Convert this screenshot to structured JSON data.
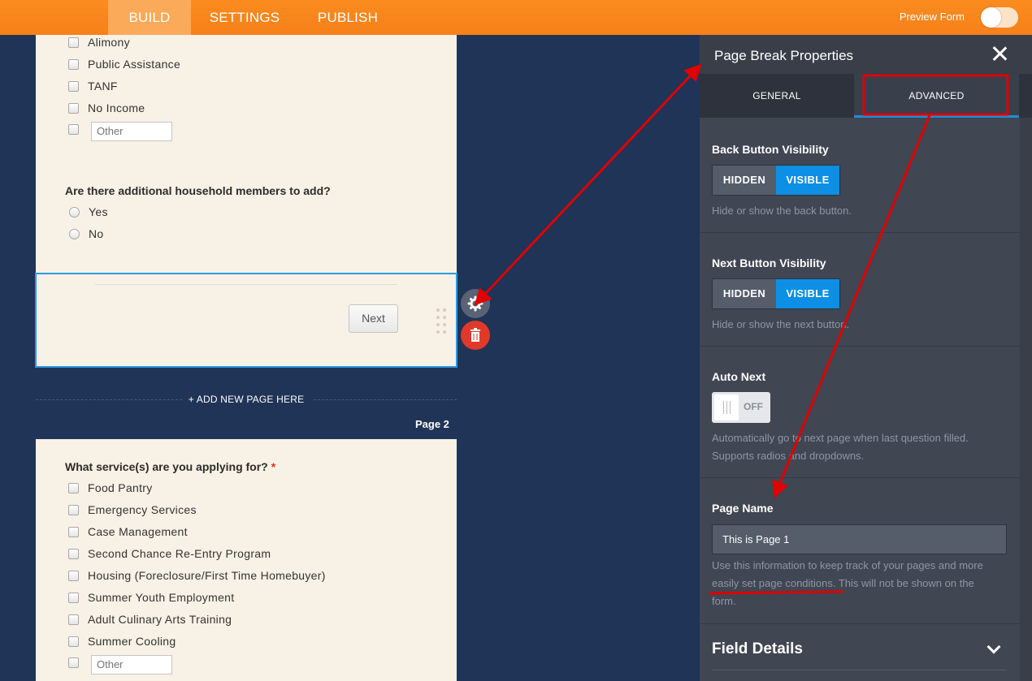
{
  "topnav": {
    "tabs": [
      "BUILD",
      "SETTINGS",
      "PUBLISH"
    ],
    "preview_label": "Preview Form"
  },
  "form": {
    "income_options": [
      "Alimony",
      "Public Assistance",
      "TANF",
      "No Income"
    ],
    "other_placeholder": "Other",
    "household_question": "Are there additional household members to add?",
    "household_options": [
      "Yes",
      "No"
    ],
    "next_button": "Next",
    "add_page": "+ ADD NEW PAGE HERE",
    "page_label": "Page 2",
    "services_question": "What service(s) are you applying for?",
    "required_mark": "*",
    "service_options": [
      "Food Pantry",
      "Emergency Services",
      "Case Management",
      "Second Chance Re-Entry Program",
      "Housing (Foreclosure/First Time Homebuyer)",
      "Summer Youth Employment",
      "Adult Culinary Arts Training",
      "Summer Cooling"
    ]
  },
  "panel": {
    "title": "Page Break Properties",
    "tabs": [
      "GENERAL",
      "ADVANCED"
    ],
    "back_visibility": {
      "label": "Back Button Visibility",
      "hidden": "HIDDEN",
      "visible": "VISIBLE",
      "hint": "Hide or show the back button."
    },
    "next_visibility": {
      "label": "Next Button Visibility",
      "hidden": "HIDDEN",
      "visible": "VISIBLE",
      "hint": "Hide or show the next button."
    },
    "auto_next": {
      "label": "Auto Next",
      "state": "OFF",
      "hint_line1": "Automatically go to next page when last question filled.",
      "hint_line2": "Supports radios and dropdowns."
    },
    "page_name": {
      "label": "Page Name",
      "value": "This is Page 1",
      "hint_line1": "Use this information to keep track of your pages and more",
      "hint_line2a": "easily set page conditions.",
      "hint_line2b": " This will not be shown on the",
      "hint_line3": "form."
    },
    "field_details": "Field Details"
  },
  "colors": {
    "brand_orange": "#f7801a",
    "canvas_navy": "#1f3457",
    "accent_blue": "#0c8fe4",
    "annotation_red": "#e00000"
  }
}
